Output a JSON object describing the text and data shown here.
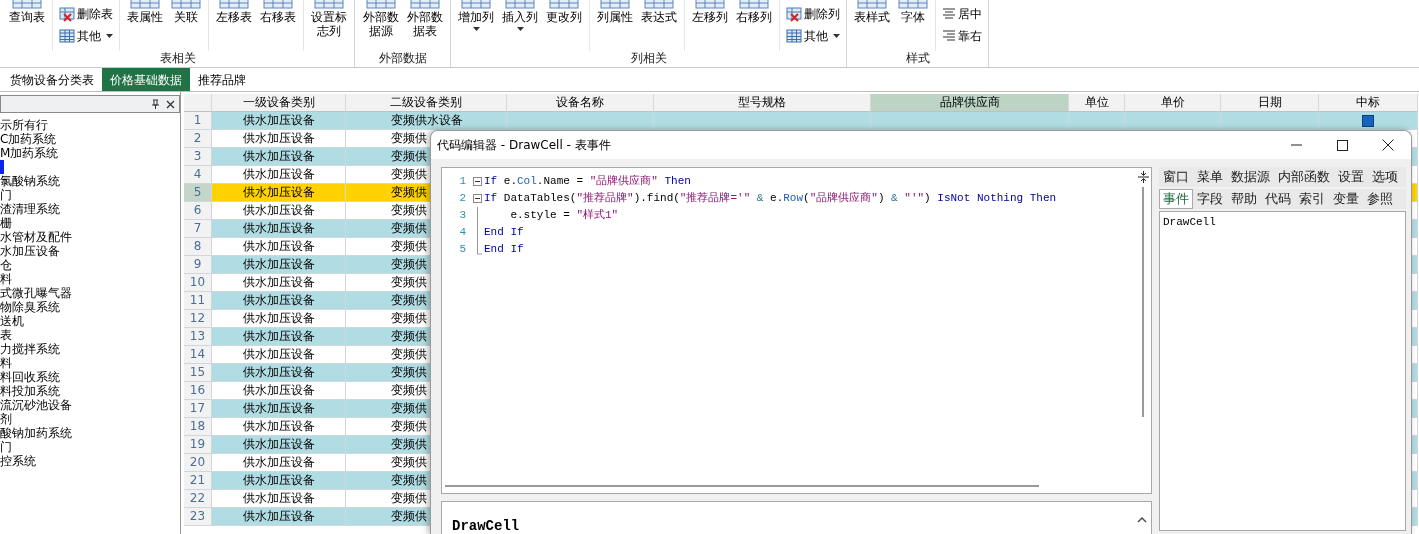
{
  "ribbon": {
    "groups": [
      {
        "label": "表相关",
        "sets": [
          [
            {
              "kind": "large",
              "label": "查询表",
              "dropdown": false
            }
          ],
          [
            {
              "kind": "delete",
              "label": "删除表",
              "dropdown": false
            },
            {
              "kind": "menu",
              "label": "其他",
              "dropdown": true
            }
          ],
          [
            {
              "kind": "large",
              "label": "表属性",
              "dropdown": false
            },
            {
              "kind": "large",
              "label": "关联",
              "dropdown": false
            }
          ],
          [
            {
              "kind": "large",
              "label": "左移表",
              "dropdown": false
            },
            {
              "kind": "large",
              "label": "右移表",
              "dropdown": false
            }
          ],
          [
            {
              "kind": "large",
              "label": "设置标志列",
              "dropdown": false
            }
          ]
        ]
      },
      {
        "label": "外部数据",
        "sets": [
          [
            {
              "kind": "large",
              "label": "外部数据源",
              "dropdown": false
            },
            {
              "kind": "large",
              "label": "外部数据表",
              "dropdown": false
            }
          ]
        ]
      },
      {
        "label": "列相关",
        "sets": [
          [
            {
              "kind": "large",
              "label": "增加列",
              "dropdown": true
            },
            {
              "kind": "large",
              "label": "插入列",
              "dropdown": true
            },
            {
              "kind": "large",
              "label": "更改列",
              "dropdown": false
            }
          ],
          [
            {
              "kind": "large",
              "label": "列属性",
              "dropdown": false
            },
            {
              "kind": "large",
              "label": "表达式",
              "dropdown": false
            }
          ],
          [
            {
              "kind": "large",
              "label": "左移列",
              "dropdown": false
            },
            {
              "kind": "large",
              "label": "右移列",
              "dropdown": false
            }
          ],
          [
            {
              "kind": "delete",
              "label": "删除列",
              "dropdown": false
            },
            {
              "kind": "menu",
              "label": "其他",
              "dropdown": true
            }
          ]
        ]
      },
      {
        "label": "样式",
        "sets": [
          [
            {
              "kind": "large",
              "label": "表样式",
              "dropdown": false
            },
            {
              "kind": "large",
              "label": "字体",
              "dropdown": false
            }
          ],
          [
            {
              "kind": "align-center",
              "label": "居中",
              "dropdown": false
            },
            {
              "kind": "align-right",
              "label": "靠右",
              "dropdown": false
            }
          ]
        ]
      }
    ]
  },
  "tabs": [
    {
      "label": "货物设备分类表",
      "selected": false
    },
    {
      "label": "价格基础数据",
      "selected": true
    },
    {
      "label": "推荐品牌",
      "selected": false
    }
  ],
  "left_panel": {
    "items": [
      {
        "label": "示所有行",
        "selected": false
      },
      {
        "label": "C加药系统",
        "selected": false
      },
      {
        "label": "M加药系统",
        "selected": false
      },
      {
        "selected": true
      },
      {
        "label": "氯酸钠系统",
        "selected": false
      },
      {
        "label": "门",
        "selected": false
      },
      {
        "label": "渣清理系统",
        "selected": false
      },
      {
        "label": "栅",
        "selected": false
      },
      {
        "label": "水管材及配件",
        "selected": false
      },
      {
        "label": "水加压设备",
        "selected": false
      },
      {
        "label": "仓",
        "selected": false
      },
      {
        "label": "料",
        "selected": false
      },
      {
        "label": "式微孔曝气器",
        "selected": false
      },
      {
        "label": "物除臭系统",
        "selected": false
      },
      {
        "label": "送机",
        "selected": false
      },
      {
        "label": "表",
        "selected": false
      },
      {
        "label": "力搅拌系统",
        "selected": false
      },
      {
        "label": "料",
        "selected": false
      },
      {
        "label": "料回收系统",
        "selected": false
      },
      {
        "label": "料投加系统",
        "selected": false
      },
      {
        "label": "流沉砂池设备",
        "selected": false
      },
      {
        "label": "剂",
        "selected": false
      },
      {
        "label": "酸钠加药系统",
        "selected": false
      },
      {
        "label": "门",
        "selected": false
      },
      {
        "label": "控系统",
        "selected": false
      }
    ]
  },
  "grid": {
    "columns": [
      {
        "label": "一级设备类别",
        "selected": false
      },
      {
        "label": "二级设备类别",
        "selected": false
      },
      {
        "label": "设备名称",
        "selected": false
      },
      {
        "label": "型号规格",
        "selected": false
      },
      {
        "label": "品牌供应商",
        "selected": true
      },
      {
        "label": "单位",
        "selected": false
      },
      {
        "label": "单价",
        "selected": false
      },
      {
        "label": "日期",
        "selected": false
      },
      {
        "label": "中标",
        "selected": false
      }
    ],
    "rows": [
      {
        "number": "1",
        "cells": [
          "供水加压设备",
          "变频供水设备"
        ],
        "selected": false,
        "won": true
      },
      {
        "number": "2",
        "cells": [
          "供水加压设备",
          "变频供"
        ],
        "selected": false
      },
      {
        "number": "3",
        "cells": [
          "供水加压设备",
          "变频供"
        ],
        "selected": false
      },
      {
        "number": "4",
        "cells": [
          "供水加压设备",
          "变频供"
        ],
        "selected": false
      },
      {
        "number": "5",
        "cells": [
          "供水加压设备",
          "变频供"
        ],
        "selected": true
      },
      {
        "number": "6",
        "cells": [
          "供水加压设备",
          "变频供"
        ],
        "selected": false
      },
      {
        "number": "7",
        "cells": [
          "供水加压设备",
          "变频供"
        ],
        "selected": false
      },
      {
        "number": "8",
        "cells": [
          "供水加压设备",
          "变频供"
        ],
        "selected": false
      },
      {
        "number": "9",
        "cells": [
          "供水加压设备",
          "变频供"
        ],
        "selected": false
      },
      {
        "number": "10",
        "cells": [
          "供水加压设备",
          "变频供"
        ],
        "selected": false
      },
      {
        "number": "11",
        "cells": [
          "供水加压设备",
          "变频供"
        ],
        "selected": false
      },
      {
        "number": "12",
        "cells": [
          "供水加压设备",
          "变频供"
        ],
        "selected": false
      },
      {
        "number": "13",
        "cells": [
          "供水加压设备",
          "变频供"
        ],
        "selected": false
      },
      {
        "number": "14",
        "cells": [
          "供水加压设备",
          "变频供"
        ],
        "selected": false
      },
      {
        "number": "15",
        "cells": [
          "供水加压设备",
          "变频供"
        ],
        "selected": false
      },
      {
        "number": "16",
        "cells": [
          "供水加压设备",
          "变频供"
        ],
        "selected": false
      },
      {
        "number": "17",
        "cells": [
          "供水加压设备",
          "变频供"
        ],
        "selected": false
      },
      {
        "number": "18",
        "cells": [
          "供水加压设备",
          "变频供"
        ],
        "selected": false
      },
      {
        "number": "19",
        "cells": [
          "供水加压设备",
          "变频供"
        ],
        "selected": false
      },
      {
        "number": "20",
        "cells": [
          "供水加压设备",
          "变频供"
        ],
        "selected": false
      },
      {
        "number": "21",
        "cells": [
          "供水加压设备",
          "变频供"
        ],
        "selected": false
      },
      {
        "number": "22",
        "cells": [
          "供水加压设备",
          "变频供"
        ],
        "selected": false
      },
      {
        "number": "23",
        "cells": [
          "供水加压设备",
          "变频供"
        ],
        "selected": false
      }
    ]
  },
  "dialog": {
    "title": "代码编辑器 - DrawCell - 表事件",
    "code": [
      {
        "number": "1",
        "kind": "start",
        "tokens": [
          {
            "kind": "keyword",
            "text": "If"
          },
          {
            "kind": "plain",
            "text": " e."
          },
          {
            "kind": "member",
            "text": "Col"
          },
          {
            "kind": "plain",
            "text": ".Name = "
          },
          {
            "kind": "string",
            "text": "\"品牌供应商\""
          },
          {
            "kind": "keyword",
            "text": " Then"
          }
        ]
      },
      {
        "number": "2",
        "kind": "start",
        "tokens": [
          {
            "kind": "keyword",
            "text": "If"
          },
          {
            "kind": "plain",
            "text": " DataTables("
          },
          {
            "kind": "string",
            "text": "\"推荐品牌\""
          },
          {
            "kind": "plain",
            "text": ").find("
          },
          {
            "kind": "string",
            "text": "\"推荐品牌='\""
          },
          {
            "kind": "operator",
            "text": " & "
          },
          {
            "kind": "plain",
            "text": "e."
          },
          {
            "kind": "member",
            "text": "Row"
          },
          {
            "kind": "plain",
            "text": "("
          },
          {
            "kind": "string",
            "text": "\"品牌供应商\""
          },
          {
            "kind": "plain",
            "text": ") "
          },
          {
            "kind": "operator",
            "text": "& "
          },
          {
            "kind": "string",
            "text": "\"'\""
          },
          {
            "kind": "plain",
            "text": ")"
          },
          {
            "kind": "keyword",
            "text": " IsNot Nothing Then"
          }
        ]
      },
      {
        "number": "3",
        "kind": "inner",
        "tokens": [
          {
            "kind": "plain",
            "text": "    e.style = "
          },
          {
            "kind": "string",
            "text": "\"样式1\""
          }
        ]
      },
      {
        "number": "4",
        "kind": "inner",
        "tokens": [
          {
            "kind": "keyword",
            "text": "End If"
          }
        ]
      },
      {
        "number": "5",
        "kind": "end",
        "tokens": [
          {
            "kind": "keyword",
            "text": "End If"
          }
        ]
      }
    ],
    "output": "DrawCell",
    "helper": {
      "tab_rows": [
        [
          {
            "label": "窗口",
            "selected": false
          },
          {
            "label": "菜单",
            "selected": false
          },
          {
            "label": "数据源",
            "selected": false
          },
          {
            "label": "内部函数",
            "selected": false
          },
          {
            "label": "设置",
            "selected": false
          },
          {
            "label": "选项",
            "selected": false
          }
        ],
        [
          {
            "label": "事件",
            "selected": true
          },
          {
            "label": "字段",
            "selected": false
          },
          {
            "label": "帮助",
            "selected": false
          },
          {
            "label": "代码",
            "selected": false
          },
          {
            "label": "索引",
            "selected": false
          },
          {
            "label": "变量",
            "selected": false
          },
          {
            "label": "参照",
            "selected": false
          }
        ]
      ],
      "items": [
        "DrawCell"
      ]
    }
  }
}
